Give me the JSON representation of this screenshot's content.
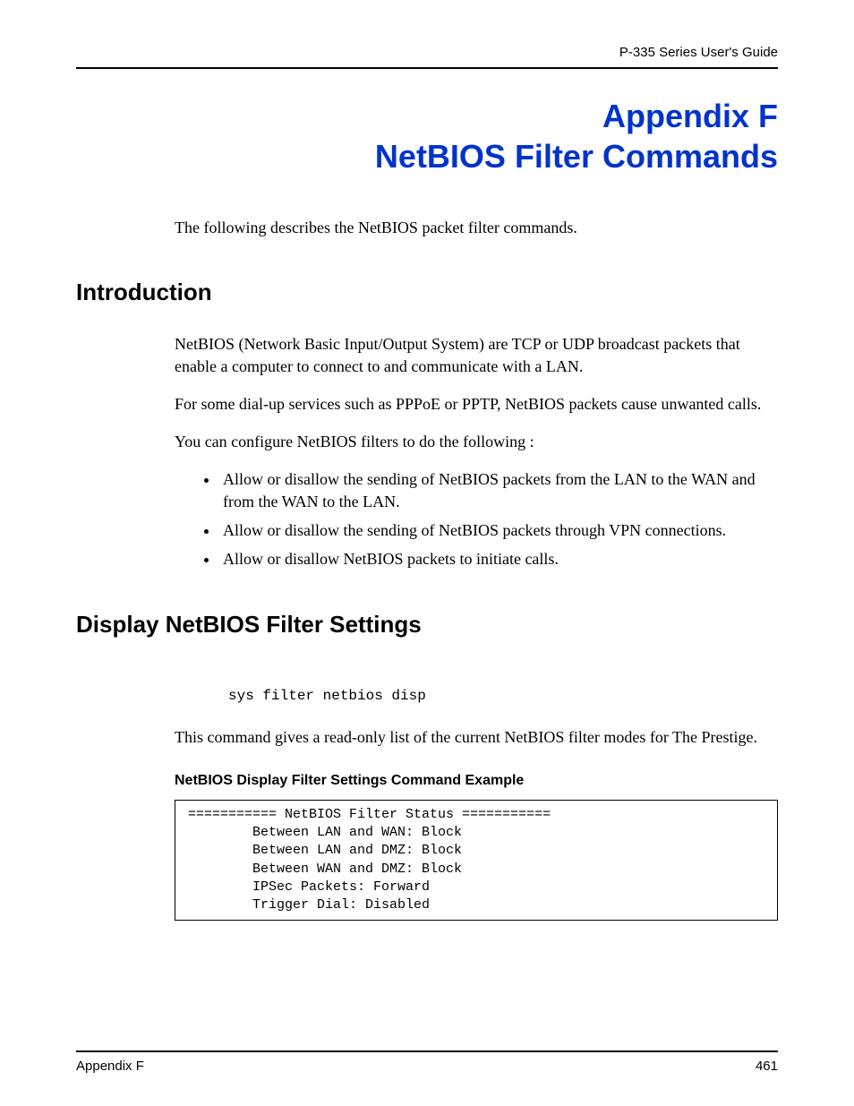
{
  "header": {
    "guide_title": "P-335 Series User's Guide"
  },
  "title": {
    "line1": "Appendix F",
    "line2": "NetBIOS Filter Commands"
  },
  "intro_sentence": "The following describes the NetBIOS packet filter commands.",
  "sections": {
    "introduction": {
      "heading": "Introduction",
      "para1": "NetBIOS (Network Basic Input/Output System) are TCP or UDP broadcast packets that enable a computer to connect to and communicate with a LAN.",
      "para2": "For some dial-up services such as PPPoE or PPTP, NetBIOS packets cause unwanted calls.",
      "para3": "You can configure NetBIOS filters to do the following :",
      "bullets": [
        "Allow or disallow the sending of NetBIOS packets from the LAN to the WAN and from the WAN to the LAN.",
        "Allow or disallow the sending of NetBIOS packets through VPN connections.",
        "Allow or disallow NetBIOS packets to initiate calls."
      ]
    },
    "display": {
      "heading": "Display NetBIOS Filter Settings",
      "command": "sys filter netbios disp",
      "para1": "This command gives a read-only list of the current NetBIOS filter modes for The Prestige.",
      "example_caption": "NetBIOS Display Filter Settings Command Example",
      "example_block": "=========== NetBIOS Filter Status ===========\n        Between LAN and WAN: Block\n        Between LAN and DMZ: Block\n        Between WAN and DMZ: Block\n        IPSec Packets: Forward\n        Trigger Dial: Disabled"
    }
  },
  "footer": {
    "left": "Appendix F",
    "page_number": "461"
  }
}
